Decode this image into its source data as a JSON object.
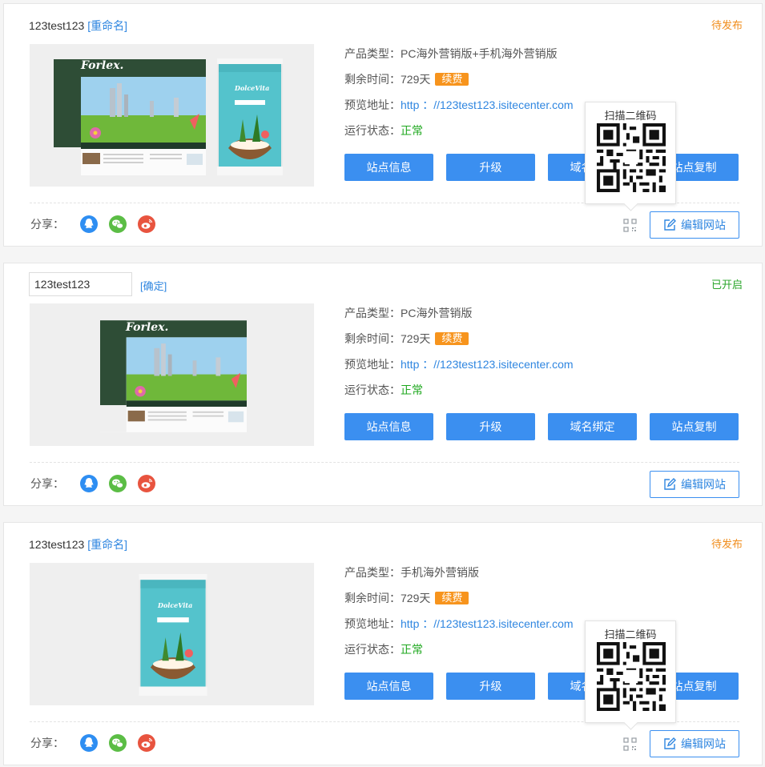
{
  "labels": {
    "product_type": "产品类型：",
    "remaining": "剩余时间：",
    "preview_url": "预览地址：",
    "run_status": "运行状态：",
    "renew": "续费",
    "share": "分享：",
    "edit_site": "编辑网站",
    "scan_qr": "扫描二维码",
    "btn_site_info": "站点信息",
    "btn_upgrade": "升级",
    "btn_domain": "域名绑定",
    "btn_copy": "站点复制"
  },
  "sites": [
    {
      "name": "123test123",
      "rename": "[重命名]",
      "status": "待发布",
      "product_type": "PC海外营销版+手机海外营销版",
      "remaining": "729天",
      "url": "http ：//123test123.isitecenter.com",
      "run_status": "正常",
      "qr_popup": true
    },
    {
      "name_input": "123test123",
      "confirm": "[确定]",
      "status": "已开启",
      "product_type": "PC海外营销版",
      "remaining": "729天",
      "url": "http ：//123test123.isitecenter.com",
      "run_status": "正常",
      "qr_popup": false
    },
    {
      "name": "123test123",
      "rename": "[重命名]",
      "status": "待发布",
      "product_type": "手机海外营销版",
      "remaining": "729天",
      "url": "http ：//123test123.isitecenter.com",
      "run_status": "正常",
      "qr_popup": true
    }
  ],
  "preview_texts": {
    "pc_logo": "Forlex.",
    "mobile_logo": "DolceVita"
  },
  "colors": {
    "accent": "#3b8ff0",
    "pending": "#f08c1a",
    "open": "#2aa52a",
    "renew": "#f7941d",
    "ok": "#1fa81f"
  }
}
